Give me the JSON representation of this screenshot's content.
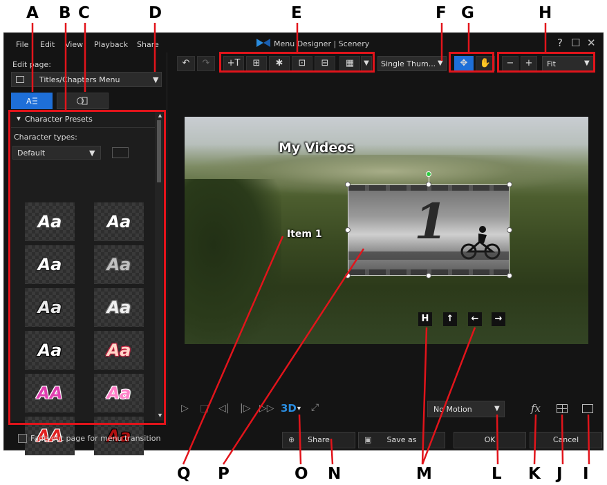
{
  "callouts": {
    "a": "A",
    "b": "B",
    "c": "C",
    "d": "D",
    "e": "E",
    "f": "F",
    "g": "G",
    "h": "H",
    "i": "I",
    "j": "J",
    "k": "K",
    "l": "L",
    "m": "M",
    "n": "N",
    "o": "O",
    "p": "P",
    "q": "Q"
  },
  "window": {
    "title": "Menu Designer | Scenery",
    "controls": {
      "help": "?",
      "maximize": "☐",
      "close": "✕"
    }
  },
  "menubar": [
    "File",
    "Edit",
    "View",
    "Playback",
    "Share"
  ],
  "left_panel": {
    "edit_page_label": "Edit page:",
    "edit_page_value": "Titles/Chapters Menu",
    "section_title": "Character Presets",
    "character_types_label": "Character types:",
    "character_types_value": "Default",
    "presets": [
      {
        "text": "Aa",
        "color": "#ffffff",
        "stroke": "#444444"
      },
      {
        "text": "Aa",
        "color": "#ffffff",
        "stroke": "#333333"
      },
      {
        "text": "Aa",
        "color": "#ffffff",
        "stroke": "#222222"
      },
      {
        "text": "Aa",
        "color": "#c0c0c0",
        "stroke": "#555555"
      },
      {
        "text": "Aa",
        "color": "#e8e8e8",
        "stroke": "#111111"
      },
      {
        "text": "Aa",
        "color": "#f0f0f0",
        "stroke": "#777777"
      },
      {
        "text": "Aa",
        "color": "#ffffff",
        "stroke": "#000000"
      },
      {
        "text": "Aa",
        "color": "#ffd6c8",
        "stroke": "#c02040"
      },
      {
        "text": "AA",
        "color": "#e040b0",
        "stroke": "#ffffff"
      },
      {
        "text": "Aa",
        "color": "#ff80c8",
        "stroke": "#ffffff"
      },
      {
        "text": "AA",
        "color": "#e02020",
        "stroke": "#ffffff"
      },
      {
        "text": "Aa",
        "color": "#b01010",
        "stroke": "#000000"
      }
    ],
    "fade_out_label": "Fade-out page for menu transition"
  },
  "toolbar": {
    "layout_value": "Single Thum...",
    "zoom_value": "Fit"
  },
  "canvas": {
    "title_text": "My Videos",
    "item_text": "Item 1",
    "thumb_number": "1",
    "nav_buttons": [
      "H",
      "↑",
      "←",
      "→"
    ]
  },
  "bottom": {
    "mode_3d": "3D",
    "motion_value": "No Motion",
    "fx_label": "fx",
    "share_label": "Share",
    "save_as_label": "Save as",
    "ok_label": "OK",
    "cancel_label": "Cancel"
  },
  "colors": {
    "accent_red": "#e2141b",
    "active_blue": "#1e6fd8",
    "background": "#141414"
  }
}
